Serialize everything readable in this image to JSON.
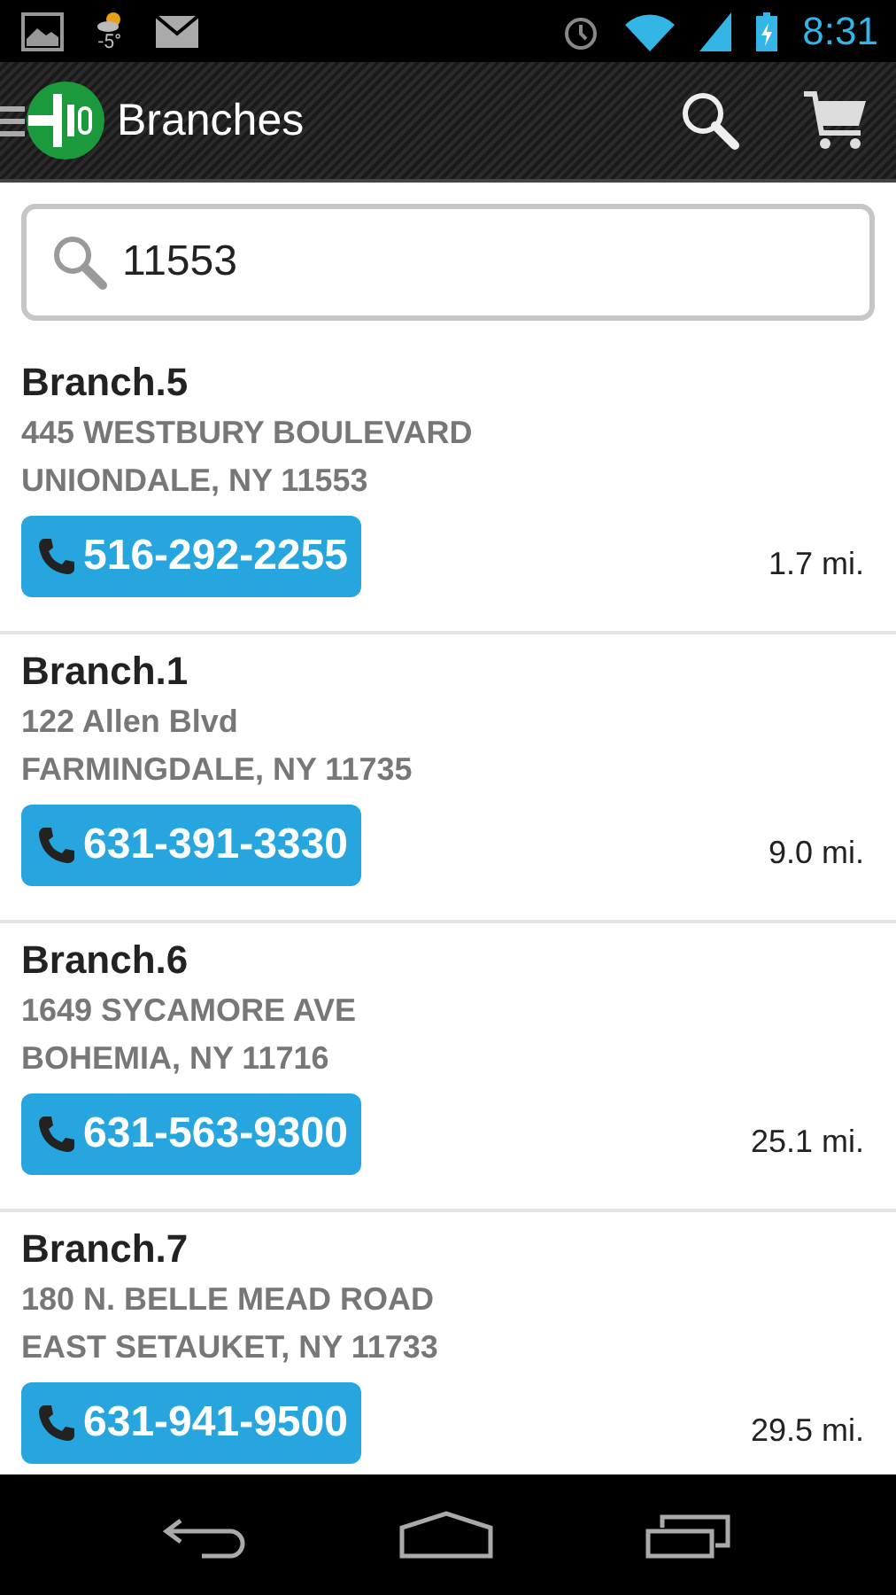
{
  "status_bar": {
    "weather": "-5°",
    "time": "8:31"
  },
  "action_bar": {
    "title": "Branches"
  },
  "search": {
    "value": "11553"
  },
  "branches": [
    {
      "name": "Branch.5",
      "address": "445 WESTBURY BOULEVARD",
      "city": "UNIONDALE, NY 11553",
      "phone": "516-292-2255",
      "distance": "1.7 mi."
    },
    {
      "name": "Branch.1",
      "address": "122 Allen Blvd",
      "city": "FARMINGDALE, NY 11735",
      "phone": "631-391-3330",
      "distance": "9.0 mi."
    },
    {
      "name": "Branch.6",
      "address": "1649 SYCAMORE AVE",
      "city": "BOHEMIA, NY 11716",
      "phone": "631-563-9300",
      "distance": "25.1 mi."
    },
    {
      "name": "Branch.7",
      "address": "180 N. BELLE MEAD ROAD",
      "city": "EAST SETAUKET, NY 11733",
      "phone": "631-941-9500",
      "distance": "29.5 mi."
    }
  ]
}
